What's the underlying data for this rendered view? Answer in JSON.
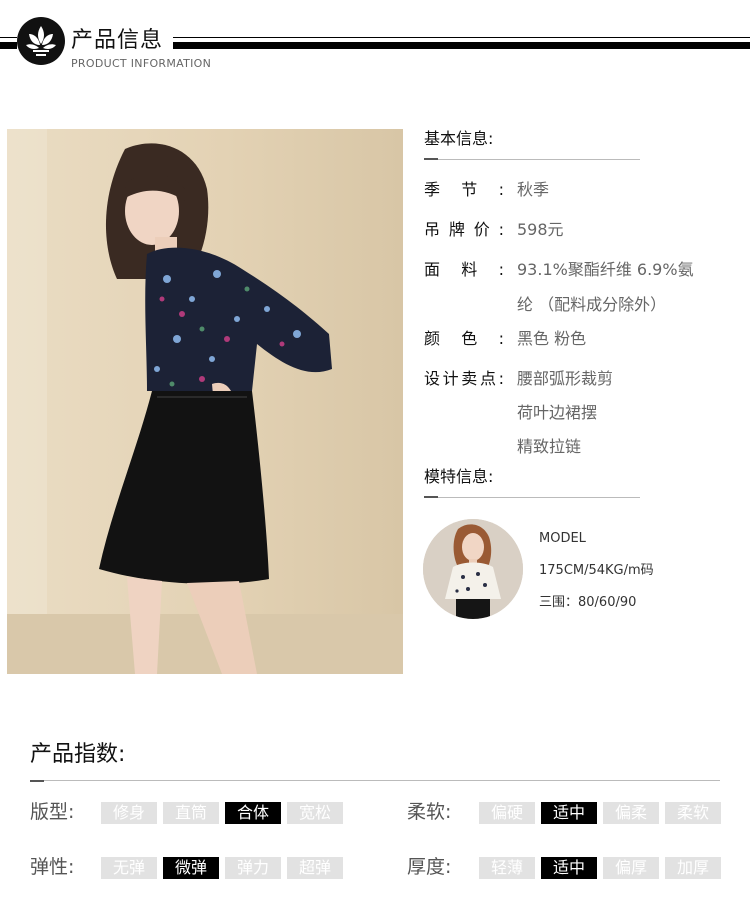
{
  "header": {
    "title": "产品信息",
    "subtitle": "PRODUCT INFORMATION",
    "logo_icon": "lotus-icon"
  },
  "basic": {
    "title": "基本信息:",
    "rows": [
      {
        "label": "季节:",
        "values": [
          "秋季"
        ]
      },
      {
        "label": "吊牌价:",
        "values": [
          "598元"
        ]
      },
      {
        "label": "面料:",
        "values": [
          "93.1%聚酯纤维 6.9%氨",
          "纶 （配料成分除外）"
        ]
      },
      {
        "label": "颜色:",
        "values": [
          "黑色 粉色"
        ]
      },
      {
        "label": "设计卖点:",
        "values": [
          "腰部弧形裁剪",
          "荷叶边裙摆",
          "精致拉链"
        ]
      }
    ]
  },
  "model": {
    "title": "模特信息:",
    "name": "MODEL",
    "size": "175CM/54KG/m码",
    "measurements": "三围：80/60/90"
  },
  "indices": {
    "title": "产品指数:",
    "groups": [
      {
        "label": "版型:",
        "options": [
          "修身",
          "直筒",
          "合体",
          "宽松"
        ],
        "selected": 2
      },
      {
        "label": "柔软:",
        "options": [
          "偏硬",
          "适中",
          "偏柔",
          "柔软"
        ],
        "selected": 1
      },
      {
        "label": "弹性:",
        "options": [
          "无弹",
          "微弹",
          "弹力",
          "超弹"
        ],
        "selected": 1
      },
      {
        "label": "厚度:",
        "options": [
          "轻薄",
          "适中",
          "偏厚",
          "加厚"
        ],
        "selected": 1
      }
    ]
  },
  "colors": {
    "accent": "#000000",
    "option_bg": "#e2e2e2",
    "photo_bg": "#e6d7bd"
  }
}
